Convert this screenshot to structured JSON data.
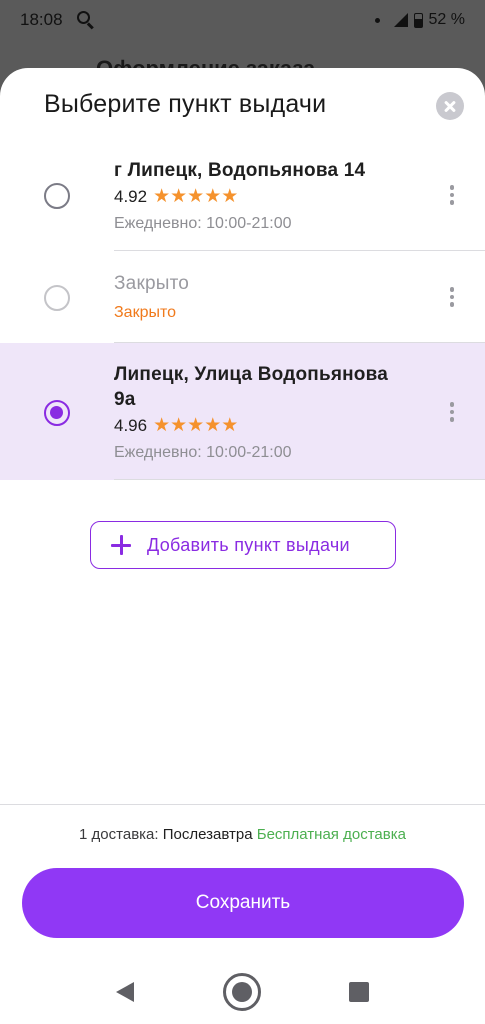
{
  "status_bar": {
    "time": "18:08",
    "battery": "52 %"
  },
  "background": {
    "title": "Оформление заказа"
  },
  "sheet": {
    "title": "Выберите пункт выдачи",
    "items": [
      {
        "address": "г Липецк, Водопьянова 14",
        "rating": "4.92",
        "stars": "★★★★★",
        "hours": "Ежедневно: 10:00-21:00",
        "state": "unselected"
      },
      {
        "address": "Закрыто",
        "status": "Закрыто",
        "state": "disabled"
      },
      {
        "address_line1": "Липецк, Улица Водопьянова",
        "address_line2": "9а",
        "rating": "4.96",
        "stars": "★★★★★",
        "hours": "Ежедневно: 10:00-21:00",
        "state": "selected"
      }
    ],
    "add_button": "Добавить пункт выдачи"
  },
  "footer": {
    "delivery_count": "1 доставка:",
    "delivery_when": "Послезавтра",
    "delivery_free": "Бесплатная доставка",
    "save_button": "Сохранить"
  },
  "colors": {
    "accent": "#9038f5",
    "selected_bg": "#efe6f9",
    "stars": "#f5922d",
    "closed": "#f07a1c",
    "free_delivery": "#4caf50"
  }
}
